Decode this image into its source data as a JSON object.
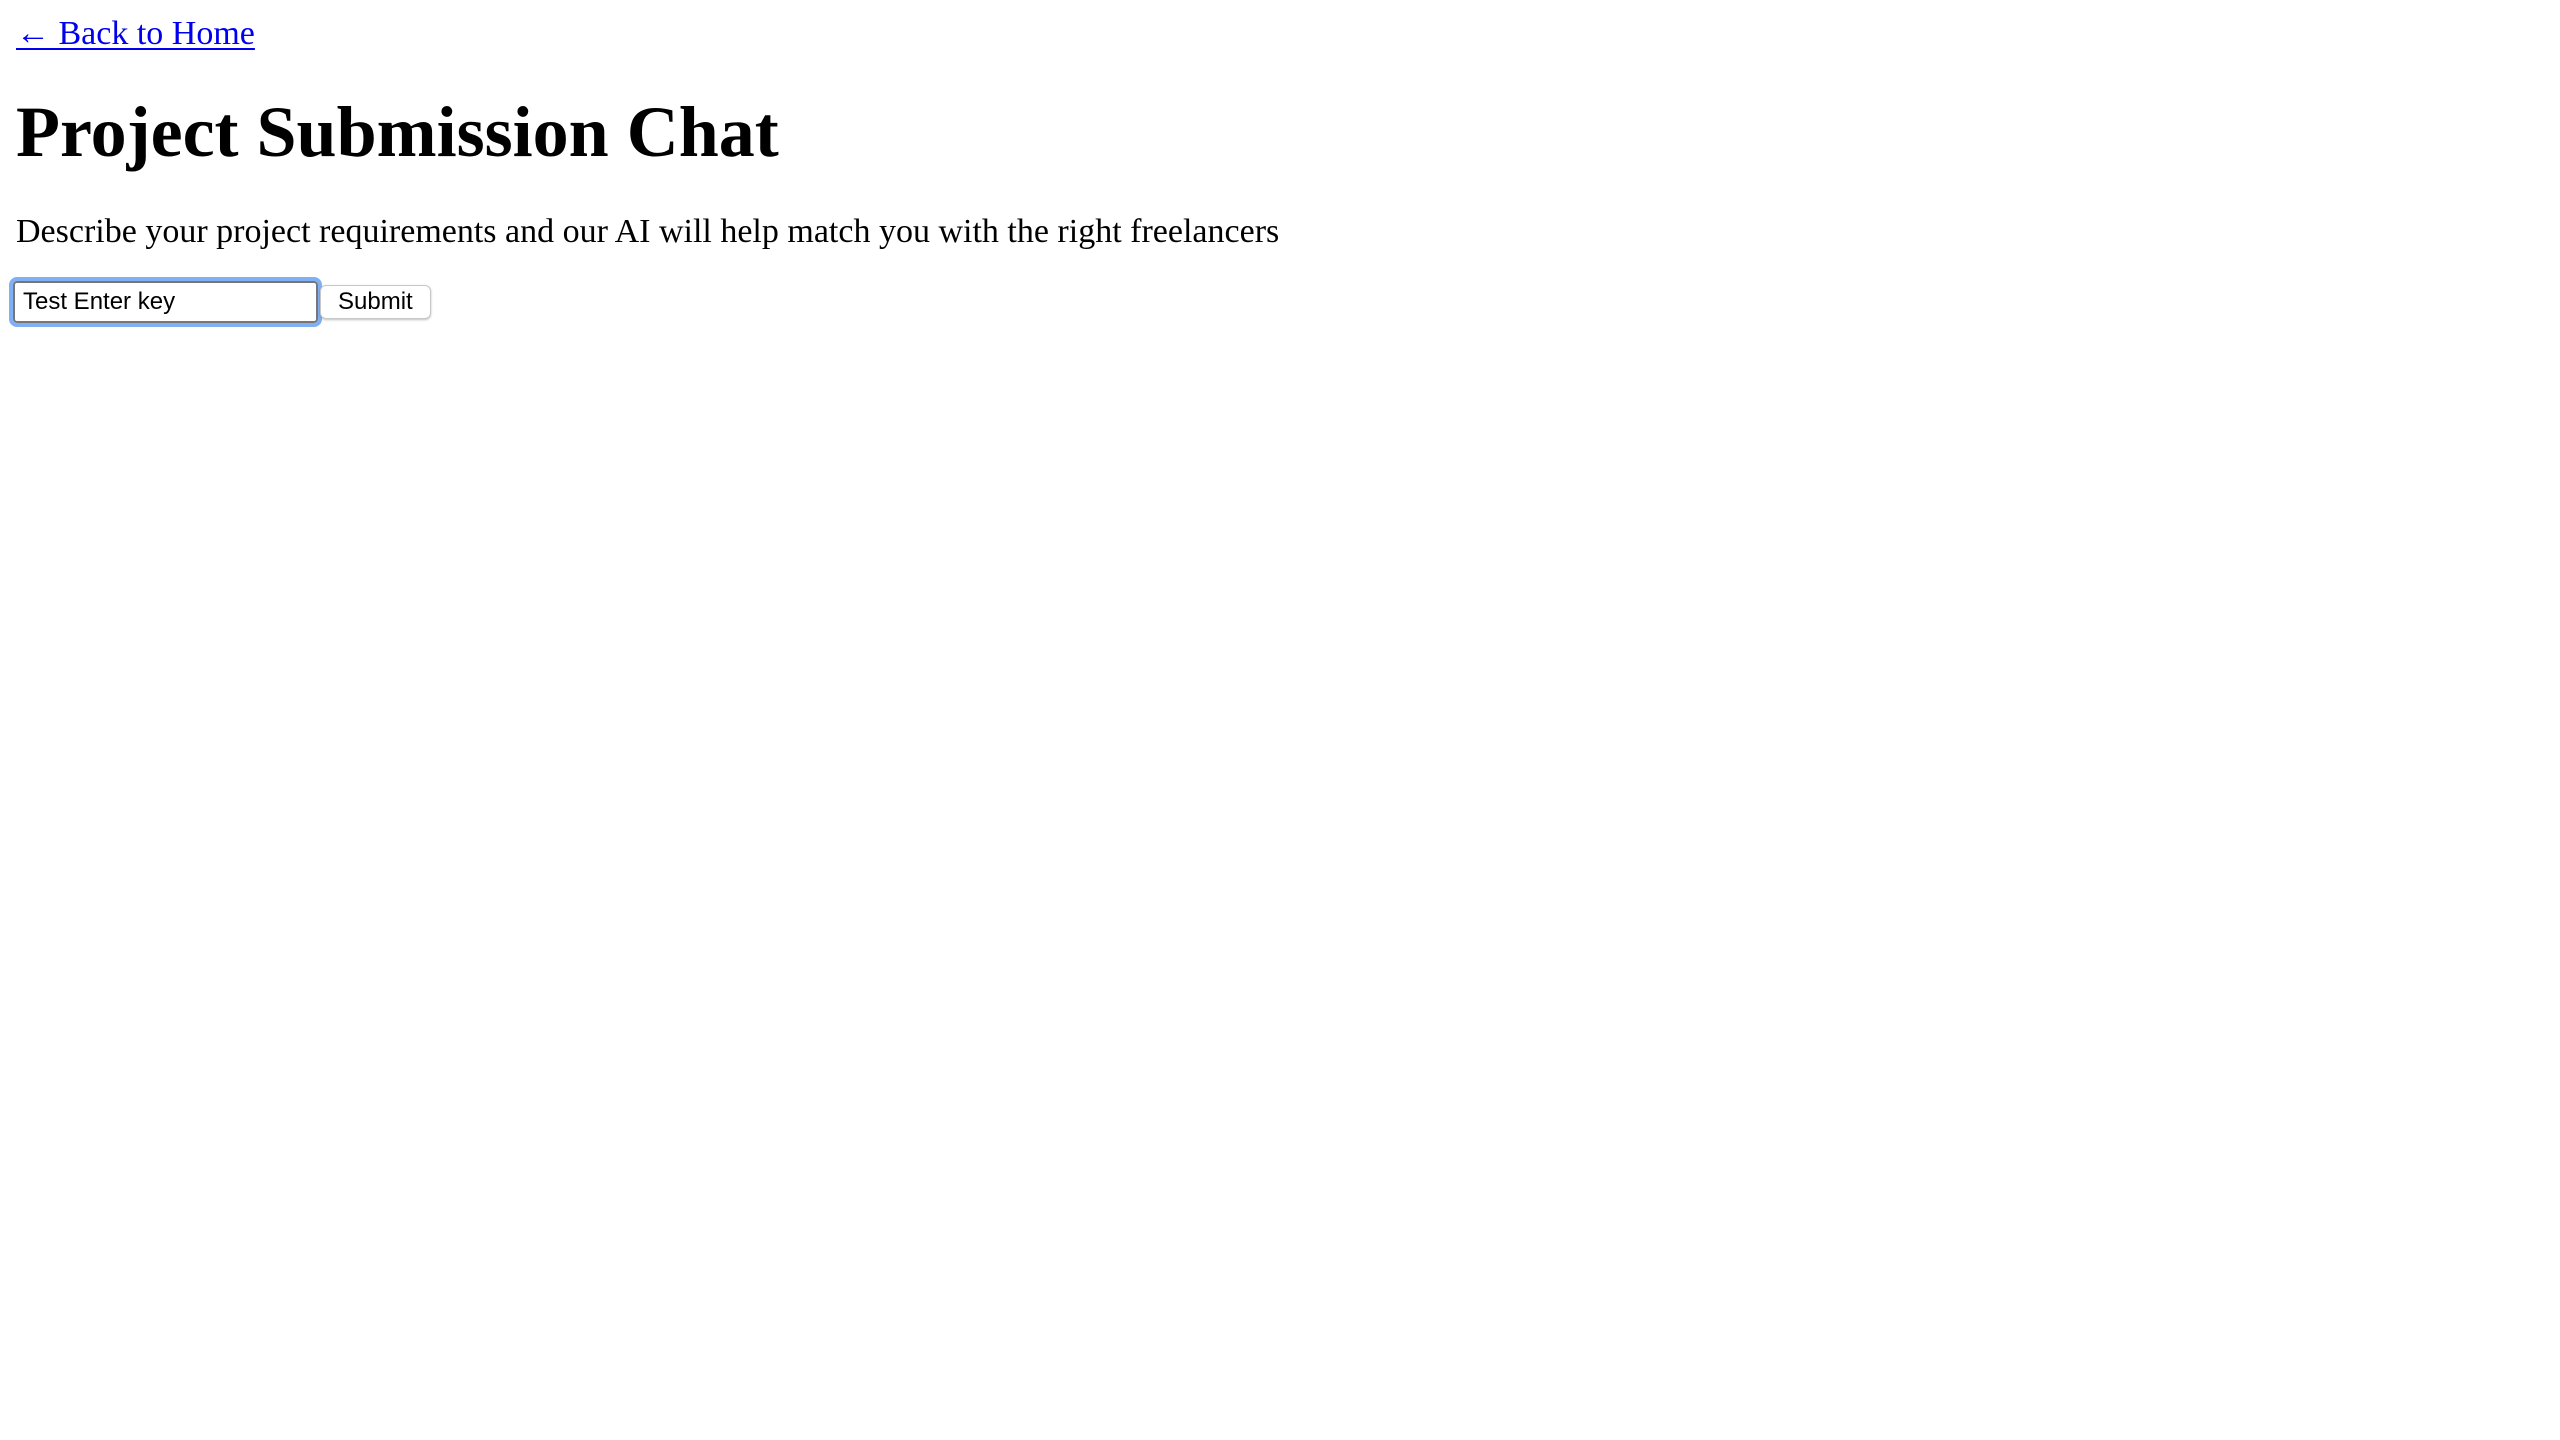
{
  "nav": {
    "back_link_label": "← Back to Home"
  },
  "header": {
    "title": "Project Submission Chat",
    "subtitle": "Describe your project requirements and our AI will help match you with the right freelancers"
  },
  "chat_form": {
    "input_value": "Test Enter key",
    "submit_label": "Submit"
  },
  "colors": {
    "link": "#0000ee",
    "focus_ring": "#7fb0f3",
    "background": "#ffffff",
    "text": "#000000"
  }
}
